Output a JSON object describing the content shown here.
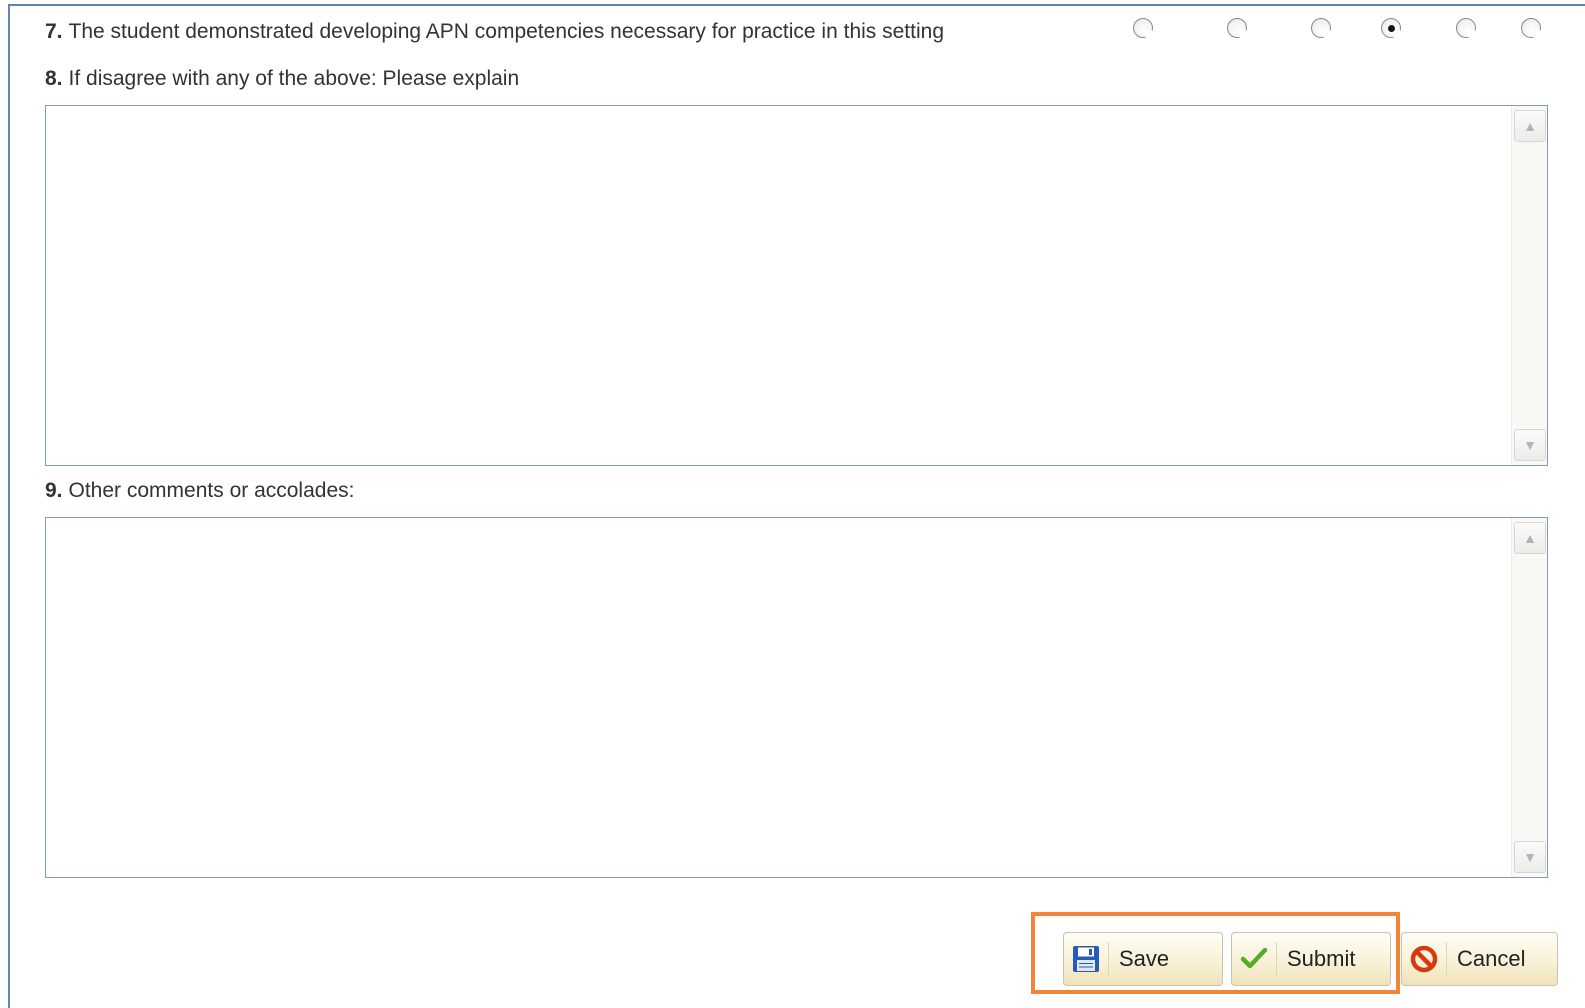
{
  "questions": {
    "q7": {
      "num": "7.",
      "text": "The student demonstrated developing APN competencies necessary for practice in this setting",
      "options_count": 6,
      "selected_index": 3
    },
    "q8": {
      "num": "8.",
      "text": "If disagree with any of the above: Please explain",
      "value": ""
    },
    "q9": {
      "num": "9.",
      "text": "Other comments or accolades:",
      "value": ""
    }
  },
  "buttons": {
    "save": {
      "label": "Save",
      "icon": "floppy-disk-icon"
    },
    "submit": {
      "label": "Submit",
      "icon": "checkmark-icon"
    },
    "cancel": {
      "label": "Cancel",
      "icon": "no-entry-icon"
    }
  },
  "colors": {
    "frame_border": "#5f84b5",
    "highlight": "#f48436",
    "check_green": "#5aaa2a",
    "cancel_red": "#d63a12",
    "save_blue": "#2a5ab8"
  }
}
